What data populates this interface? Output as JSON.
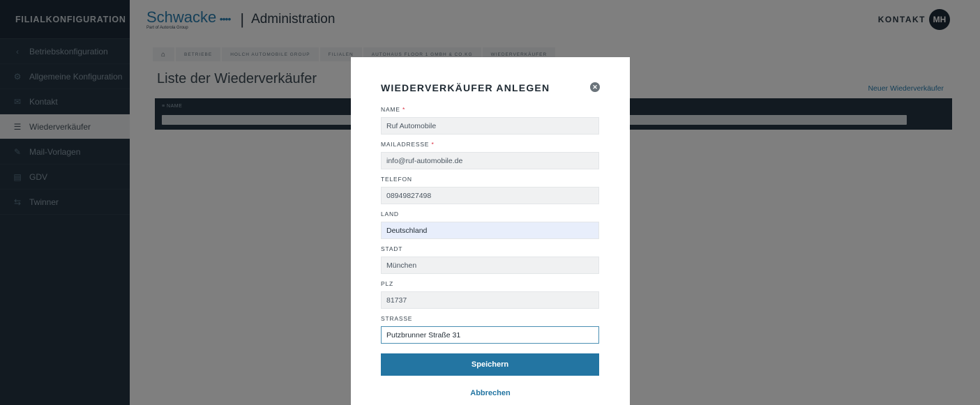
{
  "sidebar": {
    "title": "FILIALKONFIGURATION",
    "items": [
      {
        "label": "Betriebskonfiguration",
        "icon": "chevron-left-icon",
        "glyph": "‹"
      },
      {
        "label": "Allgemeine Konfiguration",
        "icon": "settings-icon",
        "glyph": "⚙"
      },
      {
        "label": "Kontakt",
        "icon": "mail-icon",
        "glyph": "✉"
      },
      {
        "label": "Wiederverkäufer",
        "icon": "list-icon",
        "glyph": "☰"
      },
      {
        "label": "Mail-Vorlagen",
        "icon": "edit-icon",
        "glyph": "✎"
      },
      {
        "label": "GDV",
        "icon": "document-icon",
        "glyph": "▤"
      },
      {
        "label": "Twinner",
        "icon": "car-icon",
        "glyph": "⇆"
      }
    ]
  },
  "header": {
    "logo_main": "Schwacke",
    "logo_dots": "••••",
    "logo_sub": "Part of Autorola Group",
    "separator": "|",
    "title": "Administration",
    "contact": "KONTAKT",
    "avatar": "MH"
  },
  "breadcrumb": {
    "home_glyph": "⌂",
    "items": [
      "BETRIEBE",
      "HOLCH AUTOMOBILE GROUP",
      "FILIALEN",
      "AUTOHAUS FLOOR 1 GMBH & CO.KG",
      "WIEDERVERKÄUFER"
    ]
  },
  "page": {
    "title": "Liste der Wiederverkäufer",
    "new_link": "Neuer Wiederverkäufer",
    "column_name": "≡ NAME"
  },
  "modal": {
    "title": "WIEDERVERKÄUFER ANLEGEN",
    "close_glyph": "✕",
    "required_mark": "*",
    "fields": {
      "name": {
        "label": "NAME",
        "value": "Ruf Automobile"
      },
      "email": {
        "label": "MAILADRESSE",
        "value": "info@ruf-automobile.de"
      },
      "phone": {
        "label": "TELEFON",
        "value": "08949827498"
      },
      "country": {
        "label": "LAND",
        "value": "Deutschland"
      },
      "city": {
        "label": "STADT",
        "value": "München"
      },
      "zip": {
        "label": "PLZ",
        "value": "81737"
      },
      "street": {
        "label": "STRASSE",
        "value": "Putzbrunner Straße 31"
      }
    },
    "save_label": "Speichern",
    "cancel_label": "Abbrechen"
  },
  "colors": {
    "accent": "#2375a2",
    "highlight": "#f4a22c",
    "sidebar": "#243443"
  }
}
